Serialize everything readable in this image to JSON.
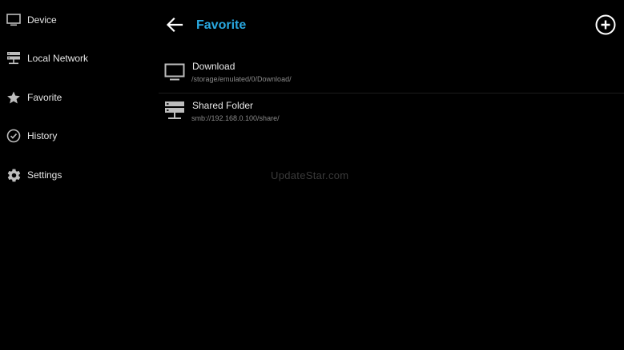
{
  "sidebar": {
    "items": [
      {
        "label": "Device",
        "icon": "monitor-icon"
      },
      {
        "label": "Local Network",
        "icon": "network-server-icon"
      },
      {
        "label": "Favorite",
        "icon": "star-icon"
      },
      {
        "label": "History",
        "icon": "clock-check-icon"
      },
      {
        "label": "Settings",
        "icon": "gear-icon"
      }
    ]
  },
  "header": {
    "title": "Favorite",
    "back_icon": "arrow-left-icon",
    "add_icon": "plus-circle-icon",
    "title_color": "#29a8e0"
  },
  "favorites": [
    {
      "name": "Download",
      "path": "/storage/emulated/0/Download/",
      "icon": "monitor-icon"
    },
    {
      "name": "Shared Folder",
      "path": "smb://192.168.0.100/share/",
      "icon": "network-server-icon"
    }
  ],
  "watermark": "UpdateStar.com"
}
